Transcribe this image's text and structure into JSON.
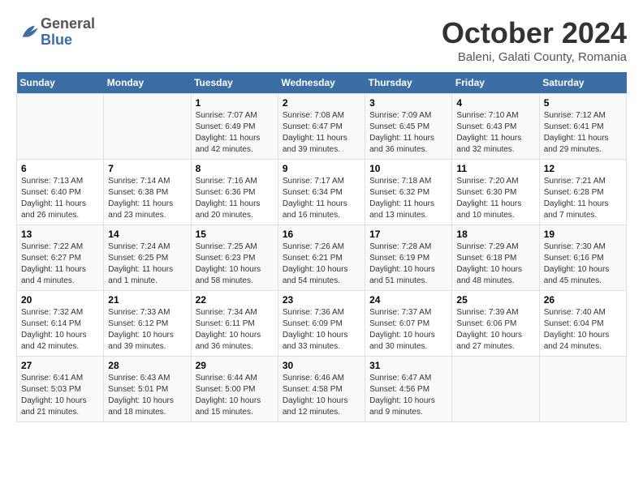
{
  "header": {
    "logo": {
      "general": "General",
      "blue": "Blue"
    },
    "title": "October 2024",
    "subtitle": "Baleni, Galati County, Romania"
  },
  "calendar": {
    "days_of_week": [
      "Sunday",
      "Monday",
      "Tuesday",
      "Wednesday",
      "Thursday",
      "Friday",
      "Saturday"
    ],
    "weeks": [
      [
        {
          "day": "",
          "sunrise": "",
          "sunset": "",
          "daylight": ""
        },
        {
          "day": "",
          "sunrise": "",
          "sunset": "",
          "daylight": ""
        },
        {
          "day": "1",
          "sunrise": "Sunrise: 7:07 AM",
          "sunset": "Sunset: 6:49 PM",
          "daylight": "Daylight: 11 hours and 42 minutes."
        },
        {
          "day": "2",
          "sunrise": "Sunrise: 7:08 AM",
          "sunset": "Sunset: 6:47 PM",
          "daylight": "Daylight: 11 hours and 39 minutes."
        },
        {
          "day": "3",
          "sunrise": "Sunrise: 7:09 AM",
          "sunset": "Sunset: 6:45 PM",
          "daylight": "Daylight: 11 hours and 36 minutes."
        },
        {
          "day": "4",
          "sunrise": "Sunrise: 7:10 AM",
          "sunset": "Sunset: 6:43 PM",
          "daylight": "Daylight: 11 hours and 32 minutes."
        },
        {
          "day": "5",
          "sunrise": "Sunrise: 7:12 AM",
          "sunset": "Sunset: 6:41 PM",
          "daylight": "Daylight: 11 hours and 29 minutes."
        }
      ],
      [
        {
          "day": "6",
          "sunrise": "Sunrise: 7:13 AM",
          "sunset": "Sunset: 6:40 PM",
          "daylight": "Daylight: 11 hours and 26 minutes."
        },
        {
          "day": "7",
          "sunrise": "Sunrise: 7:14 AM",
          "sunset": "Sunset: 6:38 PM",
          "daylight": "Daylight: 11 hours and 23 minutes."
        },
        {
          "day": "8",
          "sunrise": "Sunrise: 7:16 AM",
          "sunset": "Sunset: 6:36 PM",
          "daylight": "Daylight: 11 hours and 20 minutes."
        },
        {
          "day": "9",
          "sunrise": "Sunrise: 7:17 AM",
          "sunset": "Sunset: 6:34 PM",
          "daylight": "Daylight: 11 hours and 16 minutes."
        },
        {
          "day": "10",
          "sunrise": "Sunrise: 7:18 AM",
          "sunset": "Sunset: 6:32 PM",
          "daylight": "Daylight: 11 hours and 13 minutes."
        },
        {
          "day": "11",
          "sunrise": "Sunrise: 7:20 AM",
          "sunset": "Sunset: 6:30 PM",
          "daylight": "Daylight: 11 hours and 10 minutes."
        },
        {
          "day": "12",
          "sunrise": "Sunrise: 7:21 AM",
          "sunset": "Sunset: 6:28 PM",
          "daylight": "Daylight: 11 hours and 7 minutes."
        }
      ],
      [
        {
          "day": "13",
          "sunrise": "Sunrise: 7:22 AM",
          "sunset": "Sunset: 6:27 PM",
          "daylight": "Daylight: 11 hours and 4 minutes."
        },
        {
          "day": "14",
          "sunrise": "Sunrise: 7:24 AM",
          "sunset": "Sunset: 6:25 PM",
          "daylight": "Daylight: 11 hours and 1 minute."
        },
        {
          "day": "15",
          "sunrise": "Sunrise: 7:25 AM",
          "sunset": "Sunset: 6:23 PM",
          "daylight": "Daylight: 10 hours and 58 minutes."
        },
        {
          "day": "16",
          "sunrise": "Sunrise: 7:26 AM",
          "sunset": "Sunset: 6:21 PM",
          "daylight": "Daylight: 10 hours and 54 minutes."
        },
        {
          "day": "17",
          "sunrise": "Sunrise: 7:28 AM",
          "sunset": "Sunset: 6:19 PM",
          "daylight": "Daylight: 10 hours and 51 minutes."
        },
        {
          "day": "18",
          "sunrise": "Sunrise: 7:29 AM",
          "sunset": "Sunset: 6:18 PM",
          "daylight": "Daylight: 10 hours and 48 minutes."
        },
        {
          "day": "19",
          "sunrise": "Sunrise: 7:30 AM",
          "sunset": "Sunset: 6:16 PM",
          "daylight": "Daylight: 10 hours and 45 minutes."
        }
      ],
      [
        {
          "day": "20",
          "sunrise": "Sunrise: 7:32 AM",
          "sunset": "Sunset: 6:14 PM",
          "daylight": "Daylight: 10 hours and 42 minutes."
        },
        {
          "day": "21",
          "sunrise": "Sunrise: 7:33 AM",
          "sunset": "Sunset: 6:12 PM",
          "daylight": "Daylight: 10 hours and 39 minutes."
        },
        {
          "day": "22",
          "sunrise": "Sunrise: 7:34 AM",
          "sunset": "Sunset: 6:11 PM",
          "daylight": "Daylight: 10 hours and 36 minutes."
        },
        {
          "day": "23",
          "sunrise": "Sunrise: 7:36 AM",
          "sunset": "Sunset: 6:09 PM",
          "daylight": "Daylight: 10 hours and 33 minutes."
        },
        {
          "day": "24",
          "sunrise": "Sunrise: 7:37 AM",
          "sunset": "Sunset: 6:07 PM",
          "daylight": "Daylight: 10 hours and 30 minutes."
        },
        {
          "day": "25",
          "sunrise": "Sunrise: 7:39 AM",
          "sunset": "Sunset: 6:06 PM",
          "daylight": "Daylight: 10 hours and 27 minutes."
        },
        {
          "day": "26",
          "sunrise": "Sunrise: 7:40 AM",
          "sunset": "Sunset: 6:04 PM",
          "daylight": "Daylight: 10 hours and 24 minutes."
        }
      ],
      [
        {
          "day": "27",
          "sunrise": "Sunrise: 6:41 AM",
          "sunset": "Sunset: 5:03 PM",
          "daylight": "Daylight: 10 hours and 21 minutes."
        },
        {
          "day": "28",
          "sunrise": "Sunrise: 6:43 AM",
          "sunset": "Sunset: 5:01 PM",
          "daylight": "Daylight: 10 hours and 18 minutes."
        },
        {
          "day": "29",
          "sunrise": "Sunrise: 6:44 AM",
          "sunset": "Sunset: 5:00 PM",
          "daylight": "Daylight: 10 hours and 15 minutes."
        },
        {
          "day": "30",
          "sunrise": "Sunrise: 6:46 AM",
          "sunset": "Sunset: 4:58 PM",
          "daylight": "Daylight: 10 hours and 12 minutes."
        },
        {
          "day": "31",
          "sunrise": "Sunrise: 6:47 AM",
          "sunset": "Sunset: 4:56 PM",
          "daylight": "Daylight: 10 hours and 9 minutes."
        },
        {
          "day": "",
          "sunrise": "",
          "sunset": "",
          "daylight": ""
        },
        {
          "day": "",
          "sunrise": "",
          "sunset": "",
          "daylight": ""
        }
      ]
    ]
  }
}
